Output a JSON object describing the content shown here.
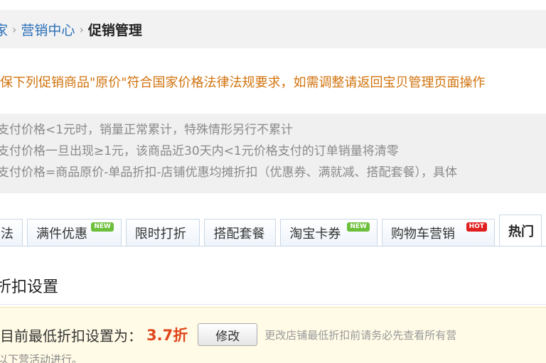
{
  "breadcrumb": {
    "items": [
      "家",
      "营销中心"
    ],
    "current": "促销管理",
    "separator": "›"
  },
  "warning_text": "保下列促销商品\"原价\"符合国家价格法律法规要求，如需调整请返回宝贝管理页面操作",
  "notes": [
    "支付价格<1元时，销量正常累计，特殊情形另行不累计",
    "支付价格一旦出现≥1元，该商品近30天内<1元价格支付的订单销量将清零",
    "支付价格=商品原价-单品折扣-店铺优惠均摊折扣（优惠券、满就减、搭配套餐），具体"
  ],
  "tabs": [
    {
      "label": "法",
      "badge": ""
    },
    {
      "label": "满件优惠",
      "badge": "NEW"
    },
    {
      "label": "限时打折",
      "badge": ""
    },
    {
      "label": "搭配套餐",
      "badge": ""
    },
    {
      "label": "淘宝卡券",
      "badge": "NEW"
    },
    {
      "label": "购物车营销",
      "badge": "HOT"
    },
    {
      "label": "热门",
      "badge": ""
    }
  ],
  "section_title": "折扣设置",
  "discount": {
    "label": "目前最低折扣设置为：",
    "value": "3.7折",
    "modify_label": "修改",
    "hint": "更改店铺最低折扣前请务必先查看所有营",
    "footer": "以下营活动进行。"
  },
  "colors": {
    "link": "#2a6fb8",
    "warning": "#d1730d",
    "accent_value": "#e0461c",
    "badge_new": "#6cbf3a",
    "badge_hot": "#e02020"
  }
}
